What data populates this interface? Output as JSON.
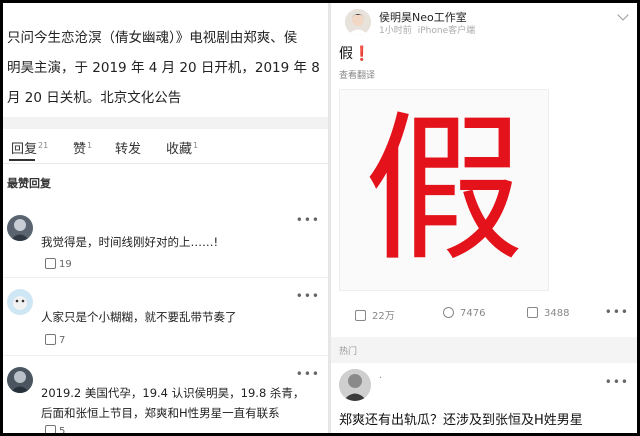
{
  "left": {
    "article_lines": [
      "只问今生恋沧溟（倩女幽魂）》电视剧由郑爽、侯",
      "明昊主演，于 2019 年 4 月 20 日开机，2019 年 8",
      "月 20 日关机。北京文化公告"
    ],
    "tabs": [
      {
        "label": "回复",
        "count": "21"
      },
      {
        "label": "赞",
        "count": "1"
      },
      {
        "label": "转发",
        "count": ""
      },
      {
        "label": "收藏",
        "count": "1"
      }
    ],
    "hot_title": "最赞回复",
    "comments": [
      {
        "text": "我觉得是，时间线刚好对的上……!",
        "likes": "19"
      },
      {
        "text": "人家只是个小糊糊，就不要乱带节奏了",
        "likes": "7"
      },
      {
        "text_lines": [
          "2019.2 美国代孕，19.4 认识侯明昊，19.8 杀青，",
          "后面和张恒上节目，郑爽和H性男星一直有联系"
        ],
        "likes": "5"
      }
    ],
    "more_glyph": "•••"
  },
  "right": {
    "account_name": "侯明昊Neo工作室",
    "time": "1小时前",
    "client": "iPhone客户端",
    "post_text": "假",
    "post_bang": "❗",
    "translate": "查看翻译",
    "image_char": "假",
    "actions": {
      "repost": "22万",
      "comment": "7476",
      "like": "3488"
    },
    "hot_label": "热门",
    "headline": "郑爽还有出轨瓜？还涉及到张恒及H姓男星",
    "second_meta": "·",
    "more_glyph": "•••"
  },
  "colors": {
    "accent_red": "#e4131b",
    "text": "#222222",
    "muted": "#888888"
  }
}
